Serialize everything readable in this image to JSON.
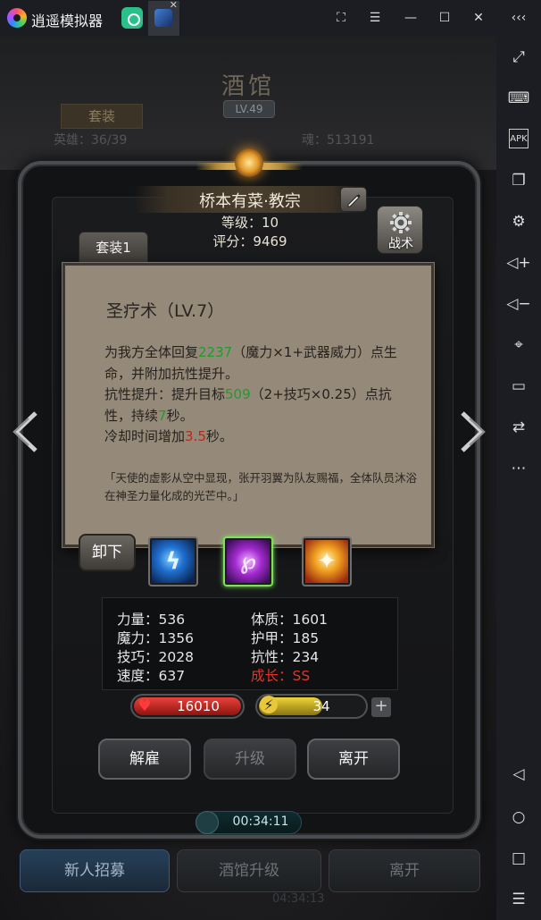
{
  "window": {
    "app_title": "逍遥模拟器"
  },
  "background": {
    "title": "酒馆",
    "level": "LV.49",
    "suit_tab": "套装",
    "count_partial": "英雄：36/39",
    "soul_partial": "魂：513191",
    "buttons": {
      "recruit": "新人招募",
      "upgrade": "酒馆升级",
      "leave": "离开"
    },
    "timer": "04:34:13"
  },
  "hero": {
    "name": "桥本有菜·教宗",
    "level": "等级：10",
    "score": "评分：9469",
    "tactics_label": "战术",
    "suit_tab": "套装1"
  },
  "skill_tooltip": {
    "title": "圣疗术（LV.7）",
    "desc": {
      "p1": "为我方全体回复",
      "heal": "2237",
      "p2": "（魔力×1+武器威力）点生命，并附加抗性提升。",
      "p3": "抗性提升：提升目标",
      "res": "509",
      "p4": "（2+技巧×0.25）点抗性，持续",
      "dur": "7",
      "p5": "秒。",
      "p6": "冷却时间增加",
      "cd": "3.5",
      "p7": "秒。"
    },
    "quote": "「天使的虚影从空中显现，张开羽翼为队友赐福，全体队员沐浴在神圣力量化成的光芒中。」"
  },
  "unequip_label": "卸下",
  "skills": [
    {
      "name": "lightning-skill-icon",
      "selected": false
    },
    {
      "name": "arcane-skill-icon",
      "selected": true
    },
    {
      "name": "holy-skill-icon",
      "selected": false
    }
  ],
  "stats": {
    "str": "力量：536",
    "con": "体质：1601",
    "mag": "魔力：1356",
    "arm": "护甲：185",
    "tec": "技巧：2028",
    "res": "抗性：234",
    "spd": "速度：637",
    "growth": "成长：SS"
  },
  "hp": {
    "value": "16010",
    "fill": 1.0
  },
  "energy": {
    "value": "34",
    "fill": 0.34
  },
  "actions": {
    "dismiss": "解雇",
    "upgrade": "升级",
    "leave": "离开"
  },
  "timer": "00:34:11",
  "colors": {
    "heal_green": "#1f9b2a",
    "cooldown_red": "#b12a1a",
    "growth_red": "#e0362a"
  }
}
